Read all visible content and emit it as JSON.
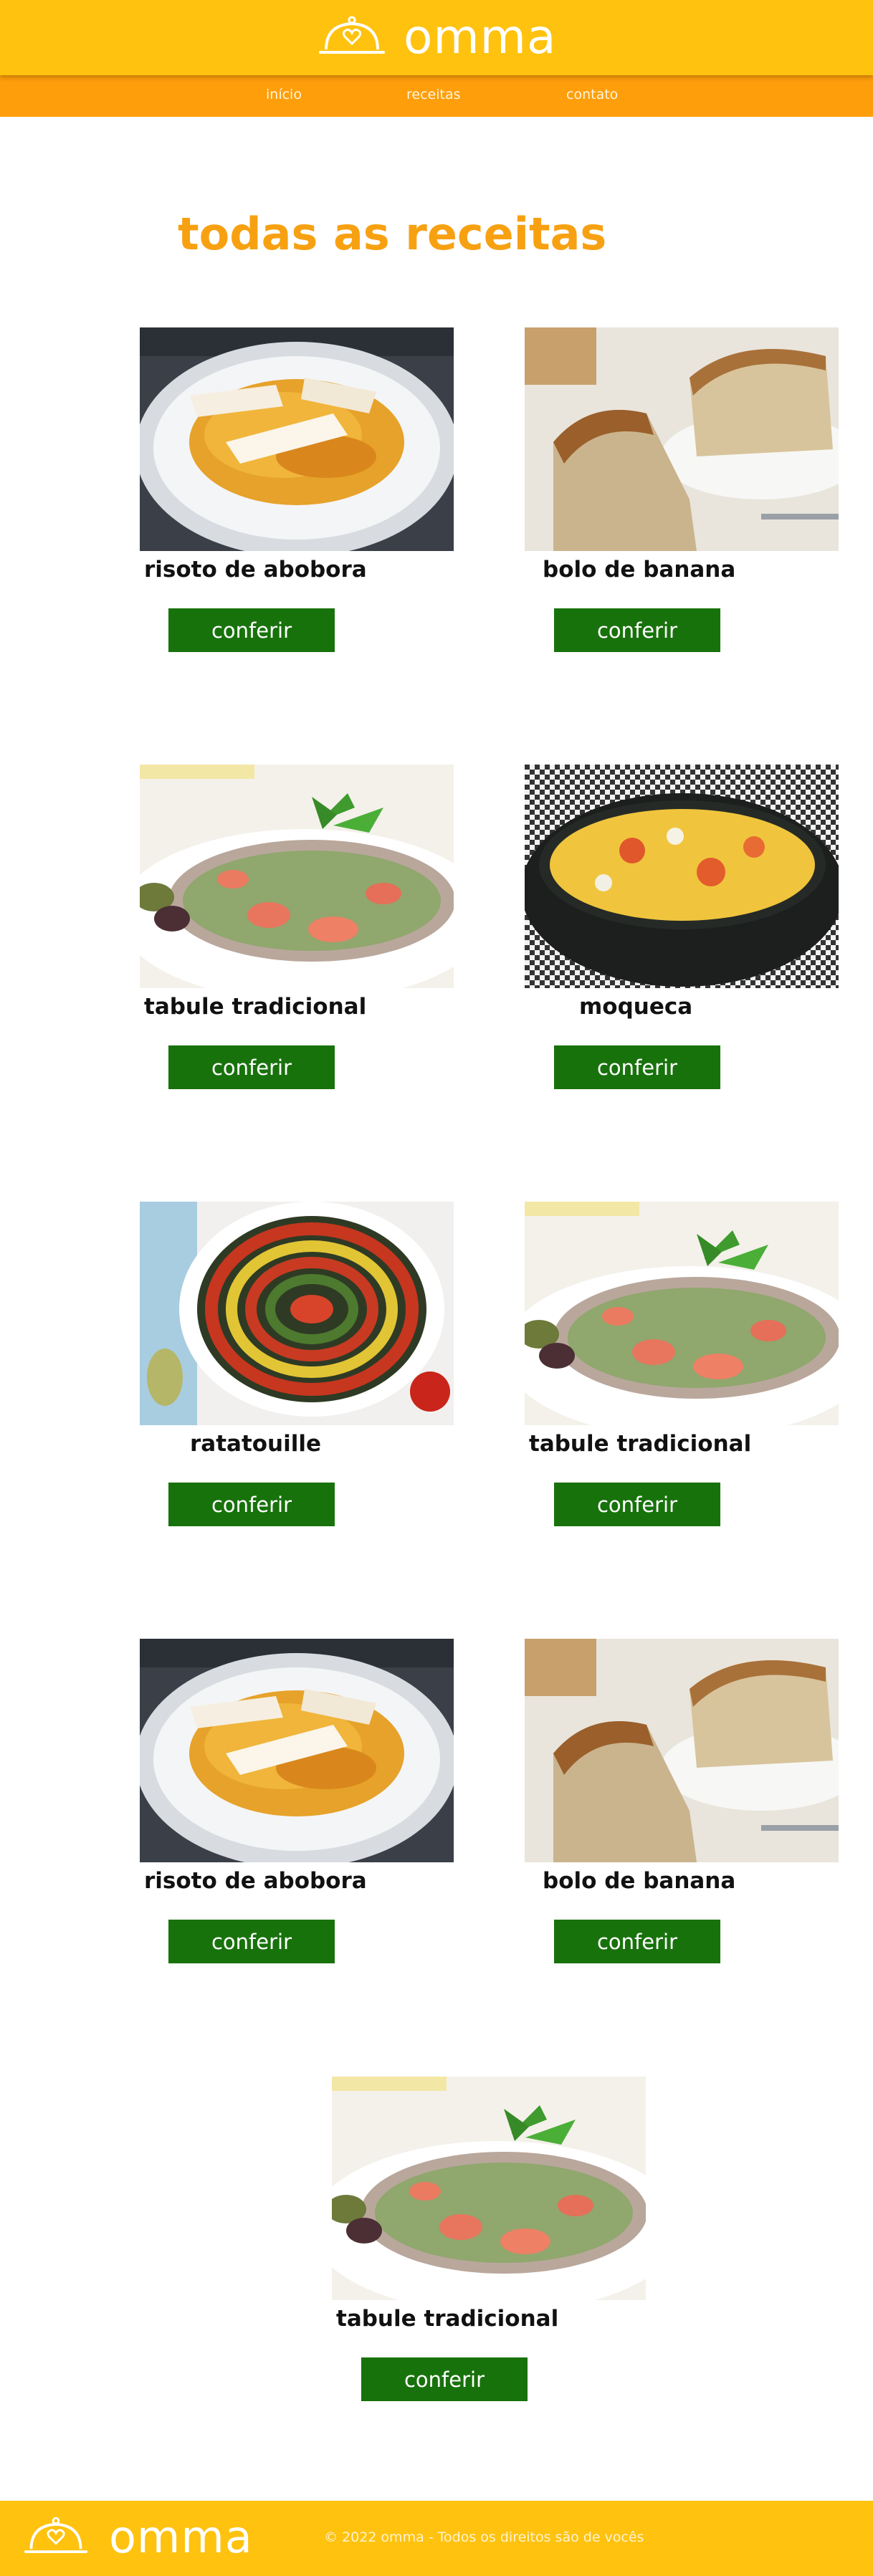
{
  "brand": {
    "name": "omma",
    "logo_icon": "cloche-heart-icon",
    "colors": {
      "header": "#ffc20e",
      "nav": "#ff9e0b",
      "title": "#f7a112",
      "button": "#18720c"
    }
  },
  "nav": {
    "items": [
      {
        "label": "início"
      },
      {
        "label": "receitas"
      },
      {
        "label": "contato"
      }
    ]
  },
  "main": {
    "title": "todas as receitas",
    "button_label": "conferir",
    "recipes": [
      {
        "name": "risoto de abobora",
        "image": "risotto-photo"
      },
      {
        "name": "bolo de banana",
        "image": "banana-cake-photo"
      },
      {
        "name": "tabule tradicional",
        "image": "tabbouleh-photo"
      },
      {
        "name": "moqueca",
        "image": "moqueca-photo"
      },
      {
        "name": "ratatouille",
        "image": "ratatouille-photo"
      },
      {
        "name": "tabule tradicional",
        "image": "tabbouleh-photo"
      },
      {
        "name": "risoto de abobora",
        "image": "risotto-photo"
      },
      {
        "name": "bolo de banana",
        "image": "banana-cake-photo"
      },
      {
        "name": "tabule tradicional",
        "image": "tabbouleh-photo"
      }
    ]
  },
  "footer": {
    "copyright": "© 2022 omma - Todos os direitos são de vocês"
  }
}
